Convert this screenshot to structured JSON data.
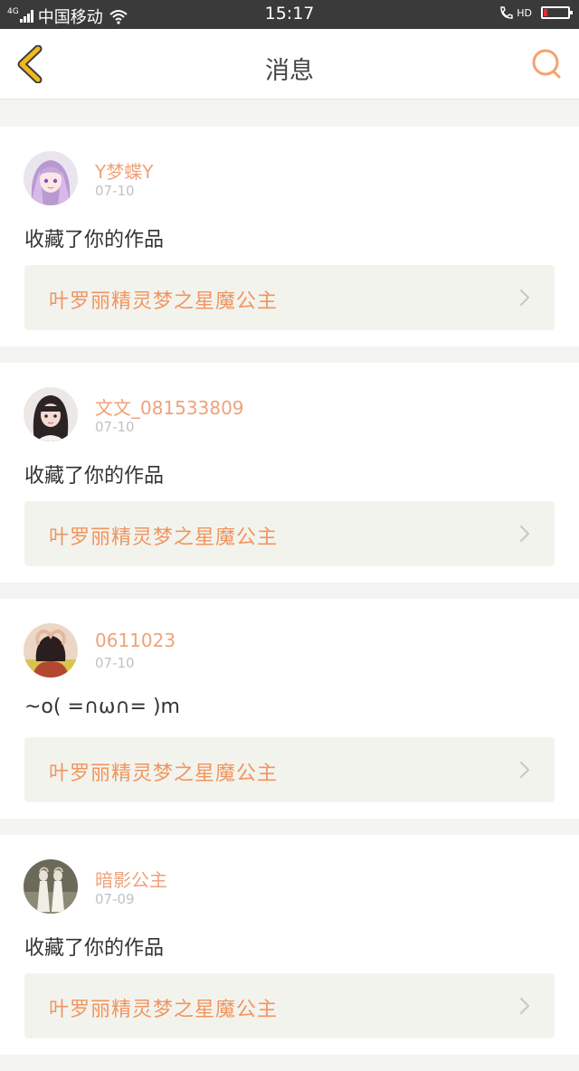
{
  "status_bar": {
    "network": "4G",
    "carrier": "中国移动",
    "time": "15:17",
    "call_badge": "HD",
    "battery_level": 0.15,
    "icons": [
      "signal-icon",
      "wifi-icon",
      "call-hd-icon",
      "battery-icon"
    ]
  },
  "header": {
    "title": "消息",
    "back_icon": "chevron-left-icon",
    "search_icon": "search-icon"
  },
  "colors": {
    "accent": "#f0955f",
    "username": "#f0a27a",
    "back_icon": "#f2b81c",
    "search_icon": "#f5a26e",
    "link_bg": "#f3f3ee",
    "page_bg": "#f4f4f2"
  },
  "messages": [
    {
      "username": "Y梦蝶Y",
      "date": "07-10",
      "text": "收藏了你的作品",
      "work_title": "叶罗丽精灵梦之星魔公主",
      "avatar": "anime-girl-avatar"
    },
    {
      "username": "文文_081533809",
      "date": "07-10",
      "text": "收藏了你的作品",
      "work_title": "叶罗丽精灵梦之星魔公主",
      "avatar": "girl-photo-avatar"
    },
    {
      "username": "0611023",
      "date": "07-10",
      "text": "~o( =∩ω∩= )m",
      "work_title": "叶罗丽精灵梦之星魔公主",
      "avatar": "heart-hands-avatar"
    },
    {
      "username": "暗影公主",
      "date": "07-09",
      "text": "收藏了你的作品",
      "work_title": "叶罗丽精灵梦之星魔公主",
      "avatar": "figures-avatar"
    }
  ]
}
